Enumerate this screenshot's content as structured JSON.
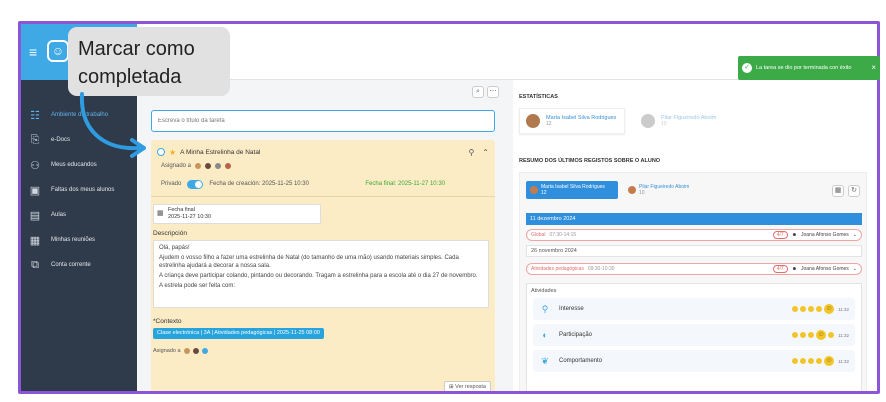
{
  "callout": {
    "line1": "Marcar como",
    "line2": "completada"
  },
  "toast": {
    "message": "La tarea se dio por terminada con éxito",
    "close": "×"
  },
  "sidebar": {
    "items": [
      {
        "label": "Ambiente de trabalho",
        "icon": "grid-icon",
        "glyph": "☷"
      },
      {
        "label": "e-Docs",
        "icon": "folder-icon",
        "glyph": "⎘"
      },
      {
        "label": "Meus educandos",
        "icon": "people-icon",
        "glyph": "⚇"
      },
      {
        "label": "Faltas dos meus alunos",
        "icon": "user-card-icon",
        "glyph": "▣"
      },
      {
        "label": "Aulas",
        "icon": "board-icon",
        "glyph": "▤"
      },
      {
        "label": "Minhas reuniões",
        "icon": "meeting-icon",
        "glyph": "▦"
      },
      {
        "label": "Conta corrente",
        "icon": "copy-icon",
        "glyph": "⧉"
      }
    ]
  },
  "task_input": {
    "placeholder": "Escreva o título da tarefa"
  },
  "task": {
    "title": "A Minha Estrelinha de Natal",
    "assigned_label": "Asignado a",
    "private_label": "Privado",
    "created": "Fecha de creación: 2025-11-25 10:30",
    "final_date": "Fecha final: 2025-11-27 10:30",
    "due_label": "Fecha final",
    "due_value": "2025-11-27 10:30",
    "description_label": "Descripción",
    "description": [
      "Olá, papás!",
      "Ajudem o vosso filho a fazer uma estrelinha de Natal (do tamanho de uma mão) usando materiais simples. Cada estrelinha ajudará a decorar a nossa sala.",
      "A criança deve participar colando, pintando ou decorando. Tragam a estrelinha para a escola até o dia 27 de novembro.",
      "A estrela pode ser feita com:"
    ],
    "context_label": "*Contexto",
    "context_value": "Clase electrónica | 3A | Atividades pedagógicas | 2025-11-25 08:00",
    "assigned2_label": "Asignado a",
    "see_response": "Ver resposta"
  },
  "right": {
    "stats_title": "ESTATÍSTICAS",
    "students": [
      {
        "name": "Marta Isabel Silva Rodrigues",
        "sub": "12"
      },
      {
        "name": "Pilar Figueiredo Aboim",
        "sub": "10"
      }
    ],
    "summary_title": "RESUMO DOS ÚLTIMOS REGISTOS SOBRE O ALUNO",
    "tabs": [
      {
        "name": "Marta Isabel Silva Rodrigues",
        "sub": "12"
      },
      {
        "name": "Pilar Figueiredo Aboim",
        "sub": "10"
      }
    ],
    "date1": "11 dezembro 2024",
    "rec1": {
      "label": "Global",
      "time": "07:30-14:15",
      "count": "4/7",
      "teacher": "Joana Afonso Gomes"
    },
    "date2": "26 novembro 2024",
    "rec2": {
      "label": "Atividades pedagógicas",
      "time": "09:30-10:30",
      "count": "4/7",
      "teacher": "Joana Afonso Gomes"
    },
    "activities_title": "Atividades",
    "activities": [
      {
        "label": "Interesse",
        "icon": "interest-icon",
        "time": "11:32"
      },
      {
        "label": "Participação",
        "icon": "participation-icon",
        "time": "11:32"
      },
      {
        "label": "Comportamento",
        "icon": "behaviour-icon",
        "time": "11:32"
      }
    ]
  },
  "colors": {
    "accent": "#3fa9e6",
    "sidebar": "#2f3b4a",
    "task_bg": "#fbecc6",
    "success": "#3daa48",
    "frame": "#8b55d8"
  }
}
